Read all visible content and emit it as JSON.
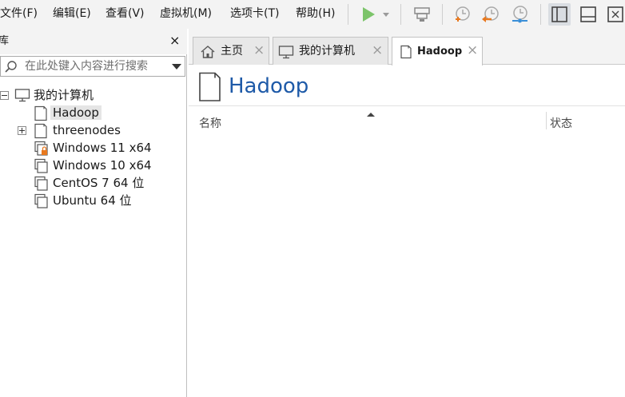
{
  "menubar": {
    "items": [
      {
        "label": "文件(F)"
      },
      {
        "label": "编辑(E)"
      },
      {
        "label": "查看(V)"
      },
      {
        "label": "虚拟机(M)"
      },
      {
        "label": "选项卡(T)"
      },
      {
        "label": "帮助(H)"
      }
    ]
  },
  "toolbar": {
    "icons": [
      "play-icon",
      "dropdown-arrow-icon",
      "send-ctrl-alt-del-icon",
      "snapshot-take-icon",
      "snapshot-revert-icon",
      "snapshot-manager-icon",
      "library-view-icon",
      "thumbnail-bar-icon",
      "fullscreen-icon"
    ],
    "accent_play": "#7cc46a",
    "accent_snapshot": "#e8791f"
  },
  "library": {
    "title": "库",
    "close_label": "×",
    "search_placeholder": "在此处键入内容进行搜索",
    "tree": {
      "root": {
        "label": "我的计算机",
        "expanded": true
      },
      "items": [
        {
          "label": "Hadoop",
          "selected": true,
          "has_children": false,
          "locked": false
        },
        {
          "label": "threenodes",
          "selected": false,
          "has_children": true,
          "locked": false
        },
        {
          "label": "Windows 11 x64",
          "selected": false,
          "has_children": false,
          "locked": true
        },
        {
          "label": "Windows 10 x64",
          "selected": false,
          "has_children": false,
          "locked": false
        },
        {
          "label": "CentOS 7 64 位",
          "selected": false,
          "has_children": false,
          "locked": false
        },
        {
          "label": "Ubuntu 64 位",
          "selected": false,
          "has_children": false,
          "locked": false
        }
      ]
    }
  },
  "tabs": [
    {
      "label": "主页",
      "icon": "home-icon",
      "active": false
    },
    {
      "label": "我的计算机",
      "icon": "computer-icon",
      "active": false
    },
    {
      "label": "Hadoop",
      "icon": "vm-icon",
      "active": true
    }
  ],
  "tab_close_label": "×",
  "main": {
    "title": "Hadoop",
    "title_color": "#1e5aa8",
    "columns": {
      "name": "名称",
      "status": "状态"
    }
  }
}
